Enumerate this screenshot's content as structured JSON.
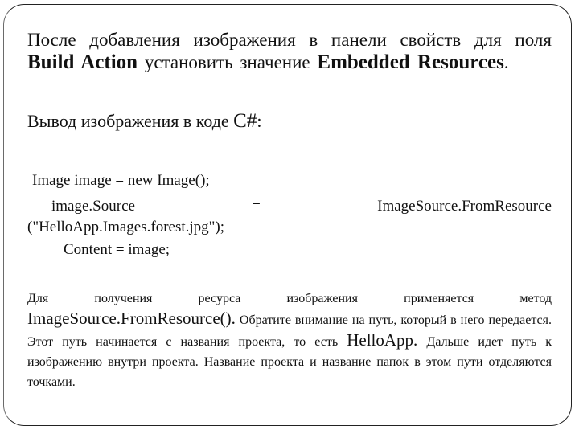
{
  "slide": {
    "intro": {
      "t1": "После добавления изображения в панели свойств для поля ",
      "b1": "Build Action",
      "t2": " установить значение ",
      "b2": "Embedded Resources",
      "t3": "."
    },
    "code_heading": {
      "text": "Вывод изображения в коде ",
      "lang": "C#",
      "colon": ":"
    },
    "code": {
      "line1": "Image image = new Image();",
      "line2_left": "image.Source",
      "line2_eq": "=",
      "line2_right": "ImageSource.FromResource",
      "line3": "(\"HelloApp.Images.forest.jpg\");",
      "line4": "Content = image;"
    },
    "explanation": {
      "first_line_words": [
        "Для",
        "получения",
        "ресурса",
        "изображения",
        "применяется",
        "метод"
      ],
      "method": "ImageSource.FromResource().",
      "t1": " Обратите внимание на путь, который в него передается. Этот путь начинается с названия проекта, то есть ",
      "project": "HelloApp.",
      "t2": " Дальше идет путь к изображению внутри проекта. Название проекта и название папок в этом пути отделяются точками."
    }
  }
}
